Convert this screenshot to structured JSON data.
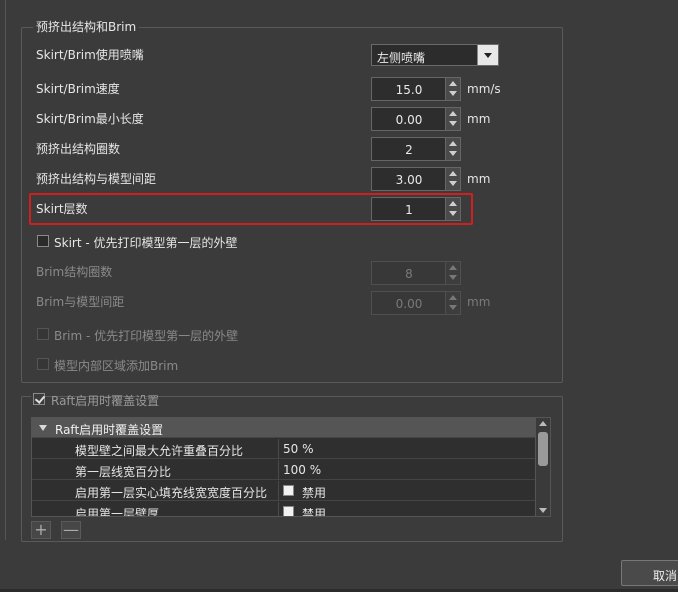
{
  "group1": {
    "title": "预挤出结构和Brim",
    "skirt_nozzle": {
      "label": "Skirt/Brim使用喷嘴",
      "value": "左侧喷嘴"
    },
    "skirt_speed": {
      "label": "Skirt/Brim速度",
      "value": "15.0",
      "unit": "mm/s"
    },
    "skirt_min_len": {
      "label": "Skirt/Brim最小长度",
      "value": "0.00",
      "unit": "mm"
    },
    "skirt_loops": {
      "label": "预挤出结构圈数",
      "value": "2"
    },
    "skirt_distance": {
      "label": "预挤出结构与模型间距",
      "value": "3.00",
      "unit": "mm"
    },
    "skirt_layers": {
      "label": "Skirt层数",
      "value": "1"
    },
    "skirt_first_wall": {
      "label": "Skirt - 优先打印模型第一层的外壁",
      "checked": false
    },
    "brim_loops": {
      "label": "Brim结构圈数",
      "value": "8"
    },
    "brim_distance": {
      "label": "Brim与模型间距",
      "value": "0.00",
      "unit": "mm"
    },
    "brim_first_wall": {
      "label": "Brim - 优先打印模型第一层的外壁",
      "checked": false
    },
    "brim_inner": {
      "label": "模型内部区域添加Brim",
      "checked": false
    }
  },
  "group2": {
    "title": "Raft启用时覆盖设置",
    "checked": true,
    "tree": {
      "header": "Raft启用时覆盖设置",
      "rows": [
        {
          "key": "模型壁之间最大允许重叠百分比",
          "value": "50 %"
        },
        {
          "key": "第一层线宽百分比",
          "value": "100 %"
        },
        {
          "key": "启用第一层实心填充线宽宽度百分比",
          "value": "禁用"
        },
        {
          "key": "启用第一层壁厚",
          "value": "禁用"
        }
      ]
    },
    "add_label": "+",
    "remove_label": "—"
  },
  "footer": {
    "cancel_label": "取消"
  },
  "colors": {
    "highlight": "#d01f1f",
    "background": "#3b3b3b"
  }
}
